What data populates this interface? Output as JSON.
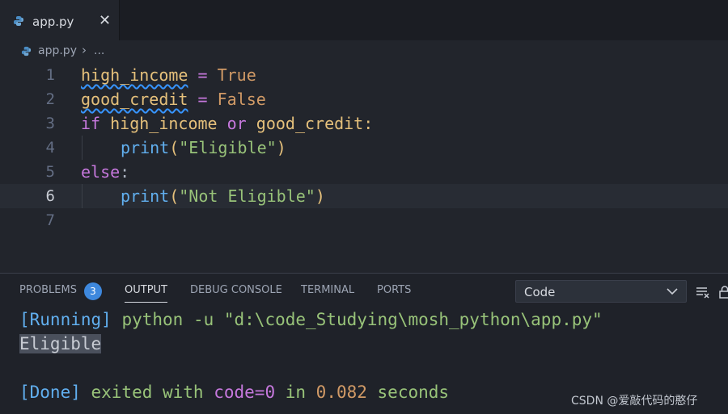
{
  "tab": {
    "filename": "app.py",
    "close_glyph": "✕"
  },
  "breadcrumb": {
    "file": "app.py",
    "separator": "›",
    "more": "..."
  },
  "editor": {
    "lines": [
      {
        "n": "1",
        "tokens": [
          "high_income",
          " = ",
          "True"
        ]
      },
      {
        "n": "2",
        "tokens": [
          "good_credit",
          " = ",
          "False"
        ]
      },
      {
        "n": "3",
        "tokens": [
          "if",
          " high_income ",
          "or",
          " good_credit:"
        ]
      },
      {
        "n": "4",
        "tokens": [
          "print",
          "(",
          "\"Eligible\"",
          ")"
        ]
      },
      {
        "n": "5",
        "tokens": [
          "else",
          ":"
        ]
      },
      {
        "n": "6",
        "tokens": [
          "print",
          "(",
          "\"Not Eligible\"",
          ")"
        ]
      },
      {
        "n": "7",
        "tokens": []
      }
    ],
    "active_line": "6"
  },
  "panel": {
    "tabs": [
      "PROBLEMS",
      "OUTPUT",
      "DEBUG CONSOLE",
      "TERMINAL",
      "PORTS"
    ],
    "active_tab": "OUTPUT",
    "problems_count": "3",
    "dropdown_value": "Code",
    "output": {
      "running_tag": "[Running]",
      "running_cmd": " python -u \"d:\\code_Studying\\mosh_python\\app.py\"",
      "result": "Eligible",
      "done_tag": "[Done]",
      "done_1": " exited with ",
      "done_code": "code=0",
      "done_2": " in ",
      "done_time": "0.082",
      "done_3": " seconds"
    }
  },
  "watermark": "CSDN @爱敲代码的憨仔",
  "colors": {
    "accent": "#3e88dd",
    "string": "#98c379",
    "keyword": "#c678dd",
    "variable": "#e5c07b"
  }
}
